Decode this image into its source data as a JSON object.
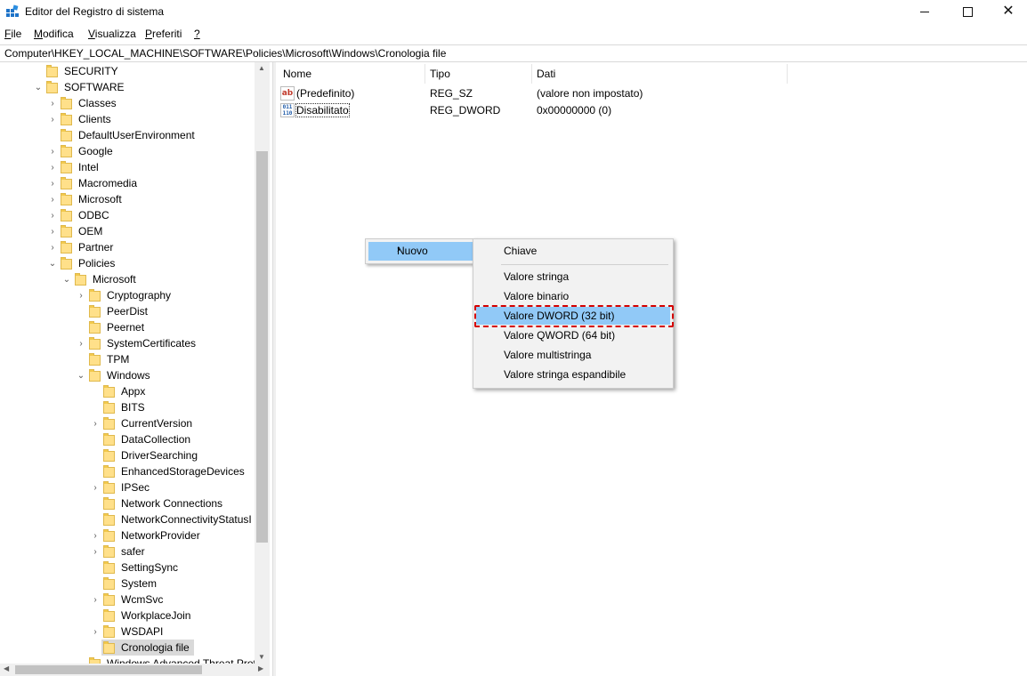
{
  "window": {
    "title": "Editor del Registro di sistema",
    "minimize": "",
    "maximize": "",
    "close": "✕"
  },
  "menu": [
    {
      "underline": "F",
      "rest": "ile"
    },
    {
      "underline": "M",
      "rest": "odifica"
    },
    {
      "underline": "V",
      "rest": "isualizza"
    },
    {
      "underline": "P",
      "rest": "referiti"
    },
    {
      "underline": "?",
      "rest": ""
    }
  ],
  "address": "Computer\\HKEY_LOCAL_MACHINE\\SOFTWARE\\Policies\\Microsoft\\Windows\\Cronologia file",
  "tree": [
    {
      "label": "SECURITY",
      "chev": ""
    },
    {
      "label": "SOFTWARE",
      "chev": "⌄"
    },
    {
      "label": "Classes",
      "chev": "›"
    },
    {
      "label": "Clients",
      "chev": "›"
    },
    {
      "label": "DefaultUserEnvironment",
      "chev": ""
    },
    {
      "label": "Google",
      "chev": "›"
    },
    {
      "label": "Intel",
      "chev": "›"
    },
    {
      "label": "Macromedia",
      "chev": "›"
    },
    {
      "label": "Microsoft",
      "chev": "›"
    },
    {
      "label": "ODBC",
      "chev": "›"
    },
    {
      "label": "OEM",
      "chev": "›"
    },
    {
      "label": "Partner",
      "chev": "›"
    },
    {
      "label": "Policies",
      "chev": "⌄"
    },
    {
      "label": "Microsoft",
      "chev": "⌄"
    },
    {
      "label": "Cryptography",
      "chev": "›"
    },
    {
      "label": "PeerDist",
      "chev": ""
    },
    {
      "label": "Peernet",
      "chev": ""
    },
    {
      "label": "SystemCertificates",
      "chev": "›"
    },
    {
      "label": "TPM",
      "chev": ""
    },
    {
      "label": "Windows",
      "chev": "⌄"
    },
    {
      "label": "Appx",
      "chev": ""
    },
    {
      "label": "BITS",
      "chev": ""
    },
    {
      "label": "CurrentVersion",
      "chev": "›"
    },
    {
      "label": "DataCollection",
      "chev": ""
    },
    {
      "label": "DriverSearching",
      "chev": ""
    },
    {
      "label": "EnhancedStorageDevices",
      "chev": ""
    },
    {
      "label": "IPSec",
      "chev": "›"
    },
    {
      "label": "Network Connections",
      "chev": ""
    },
    {
      "label": "NetworkConnectivityStatusI",
      "chev": ""
    },
    {
      "label": "NetworkProvider",
      "chev": "›"
    },
    {
      "label": "safer",
      "chev": "›"
    },
    {
      "label": "SettingSync",
      "chev": ""
    },
    {
      "label": "System",
      "chev": ""
    },
    {
      "label": "WcmSvc",
      "chev": "›"
    },
    {
      "label": "WorkplaceJoin",
      "chev": ""
    },
    {
      "label": "WSDAPI",
      "chev": "›"
    },
    {
      "label": "Cronologia file",
      "chev": ""
    },
    {
      "label": "Windows Advanced Threat Prot",
      "chev": ""
    }
  ],
  "columns": {
    "name": "Nome",
    "type": "Tipo",
    "data": "Dati"
  },
  "values": [
    {
      "icon": "ab",
      "name": "(Predefinito)",
      "type": "REG_SZ",
      "data": "(valore non impostato)"
    },
    {
      "icon": "011 110",
      "name": "Disabilitato",
      "type": "REG_DWORD",
      "data": "0x00000000 (0)"
    }
  ],
  "context_menu": {
    "parent": {
      "label": "Nuovo",
      "arrow": "›"
    },
    "items": [
      "Chiave",
      "Valore stringa",
      "Valore binario",
      "Valore DWORD (32 bit)",
      "Valore QWORD (64 bit)",
      "Valore multistringa",
      "Valore stringa espandibile"
    ],
    "highlighted": "Valore DWORD (32 bit)"
  },
  "colors": {
    "menu_highlight": "#91c9f7",
    "annotation": "#d40000",
    "folder": "#ffe08a"
  }
}
